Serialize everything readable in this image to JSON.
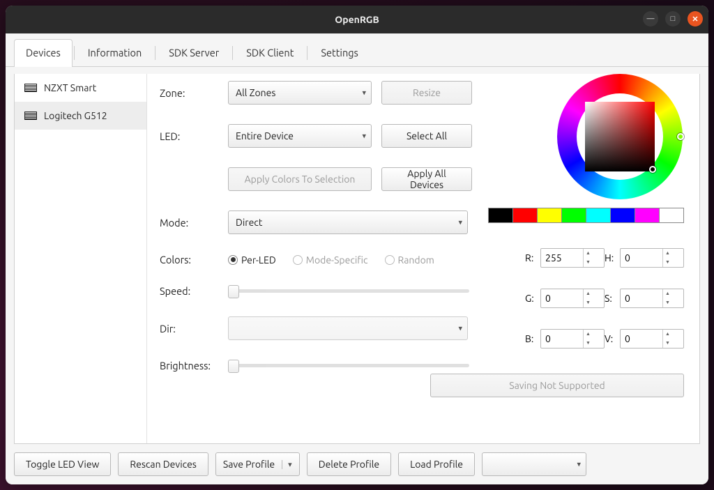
{
  "window": {
    "title": "OpenRGB"
  },
  "tabs": [
    "Devices",
    "Information",
    "SDK Server",
    "SDK Client",
    "Settings"
  ],
  "active_tab": 0,
  "devices": [
    {
      "name": "NZXT Smart"
    },
    {
      "name": "Logitech G512"
    }
  ],
  "selected_device": 1,
  "labels": {
    "zone": "Zone:",
    "led": "LED:",
    "mode": "Mode:",
    "colors": "Colors:",
    "speed": "Speed:",
    "dir": "Dir:",
    "brightness": "Brightness:"
  },
  "zone": {
    "value": "All Zones",
    "resize": "Resize"
  },
  "led": {
    "value": "Entire Device",
    "select_all": "Select All"
  },
  "apply": {
    "to_selection": "Apply Colors To Selection",
    "all_devices": "Apply All Devices"
  },
  "mode": {
    "value": "Direct"
  },
  "colors": {
    "per_led": "Per-LED",
    "mode_specific": "Mode-Specific",
    "random": "Random",
    "selected": "per_led"
  },
  "swatches": [
    "#000000",
    "#ff0000",
    "#ffff00",
    "#00ff00",
    "#00ffff",
    "#0000ff",
    "#ff00ff",
    "#ffffff"
  ],
  "rgb": {
    "r_label": "R:",
    "g_label": "G:",
    "b_label": "B:",
    "r": "255",
    "g": "0",
    "b": "0"
  },
  "hsv": {
    "h_label": "H:",
    "s_label": "S:",
    "v_label": "V:",
    "h": "0",
    "s": "0",
    "v": "0"
  },
  "save_color_btn": "Saving Not Supported",
  "bottom": {
    "toggle_led_view": "Toggle LED View",
    "rescan": "Rescan Devices",
    "save_profile": "Save Profile",
    "delete_profile": "Delete Profile",
    "load_profile": "Load Profile"
  }
}
